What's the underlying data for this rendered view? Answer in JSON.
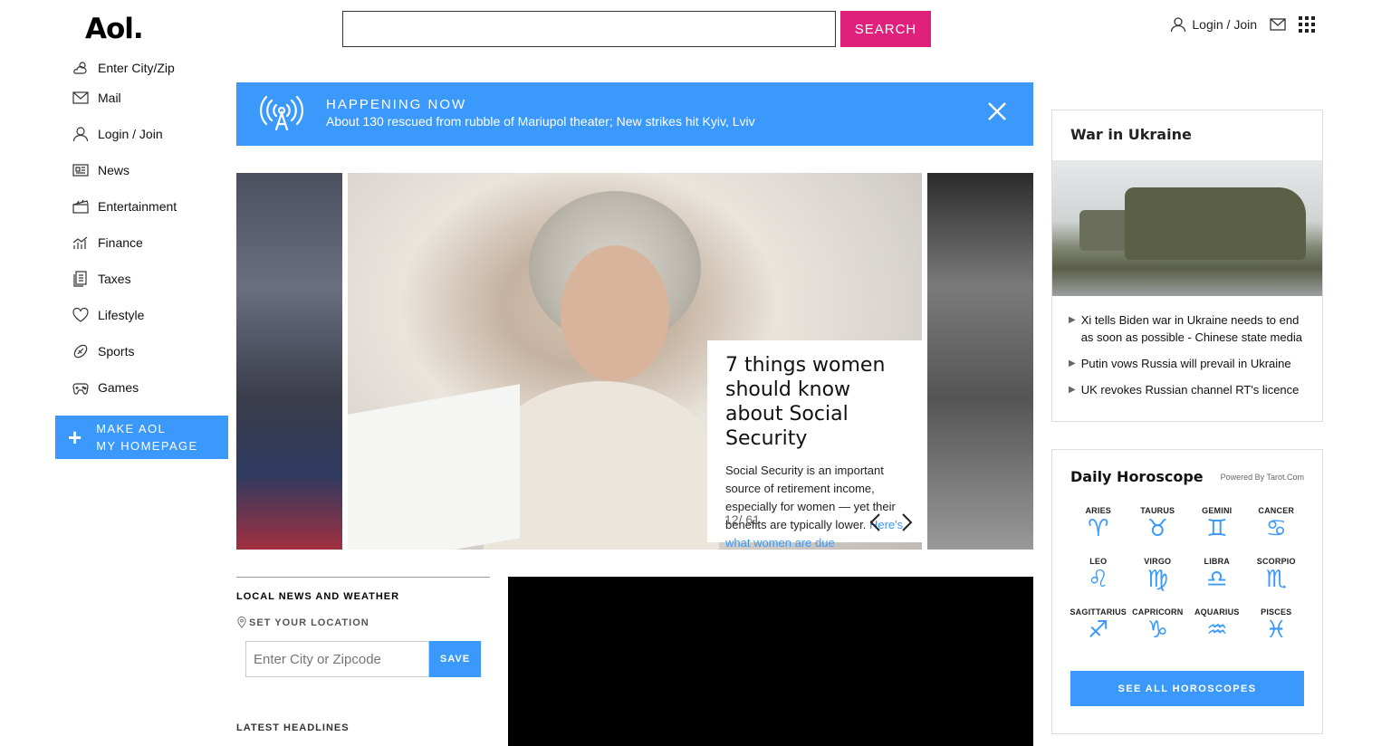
{
  "header": {
    "logo": "Aol.",
    "search_placeholder": "",
    "search_button": "SEARCH",
    "login_label": "Login / Join"
  },
  "sidebar": {
    "items": [
      {
        "label": "Enter City/Zip",
        "icon": "weather-icon"
      },
      {
        "label": "Mail",
        "icon": "mail-icon"
      },
      {
        "label": "Login / Join",
        "icon": "user-icon"
      },
      {
        "label": "News",
        "icon": "news-icon"
      },
      {
        "label": "Entertainment",
        "icon": "clapper-icon"
      },
      {
        "label": "Finance",
        "icon": "chart-icon"
      },
      {
        "label": "Taxes",
        "icon": "document-icon"
      },
      {
        "label": "Lifestyle",
        "icon": "heart-icon"
      },
      {
        "label": "Sports",
        "icon": "football-icon"
      },
      {
        "label": "Games",
        "icon": "gamepad-icon"
      }
    ],
    "make_homepage_line1": "MAKE AOL",
    "make_homepage_line2": "MY HOMEPAGE"
  },
  "banner": {
    "title": "HAPPENING NOW",
    "text": "About 130 rescued from rubble of Mariupol theater; New strikes hit Kyiv, Lviv"
  },
  "carousel": {
    "title": "7 things women should know about Social Security",
    "body": "Social Security is an important source of retirement income, especially for women — yet their benefits are typically lower.",
    "link": "Here's what women are due",
    "counter": "12/ 61"
  },
  "local": {
    "title": "LOCAL NEWS AND WEATHER",
    "set_location": "SET YOUR LOCATION",
    "input_placeholder": "Enter City or Zipcode",
    "save": "SAVE",
    "latest": "LATEST HEADLINES"
  },
  "ukraine": {
    "title": "War in Ukraine",
    "items": [
      "Xi tells Biden war in Ukraine needs to end as soon as possible - Chinese state media",
      "Putin vows Russia will prevail in Ukraine",
      "UK revokes Russian channel RT's licence"
    ]
  },
  "horoscope": {
    "title": "Daily Horoscope",
    "powered": "Powered By Tarot.Com",
    "signs": [
      {
        "name": "ARIES",
        "glyph": "♈"
      },
      {
        "name": "TAURUS",
        "glyph": "♉"
      },
      {
        "name": "GEMINI",
        "glyph": "♊"
      },
      {
        "name": "CANCER",
        "glyph": "♋"
      },
      {
        "name": "LEO",
        "glyph": "♌"
      },
      {
        "name": "VIRGO",
        "glyph": "♍"
      },
      {
        "name": "LIBRA",
        "glyph": "♎"
      },
      {
        "name": "SCORPIO",
        "glyph": "♏"
      },
      {
        "name": "SAGITTARIUS",
        "glyph": "♐"
      },
      {
        "name": "CAPRICORN",
        "glyph": "♑"
      },
      {
        "name": "AQUARIUS",
        "glyph": "♒"
      },
      {
        "name": "PISCES",
        "glyph": "♓"
      }
    ],
    "button": "SEE ALL HOROSCOPES"
  },
  "colors": {
    "accent_blue": "#3b99fc",
    "search_pink": "#e0217c"
  }
}
